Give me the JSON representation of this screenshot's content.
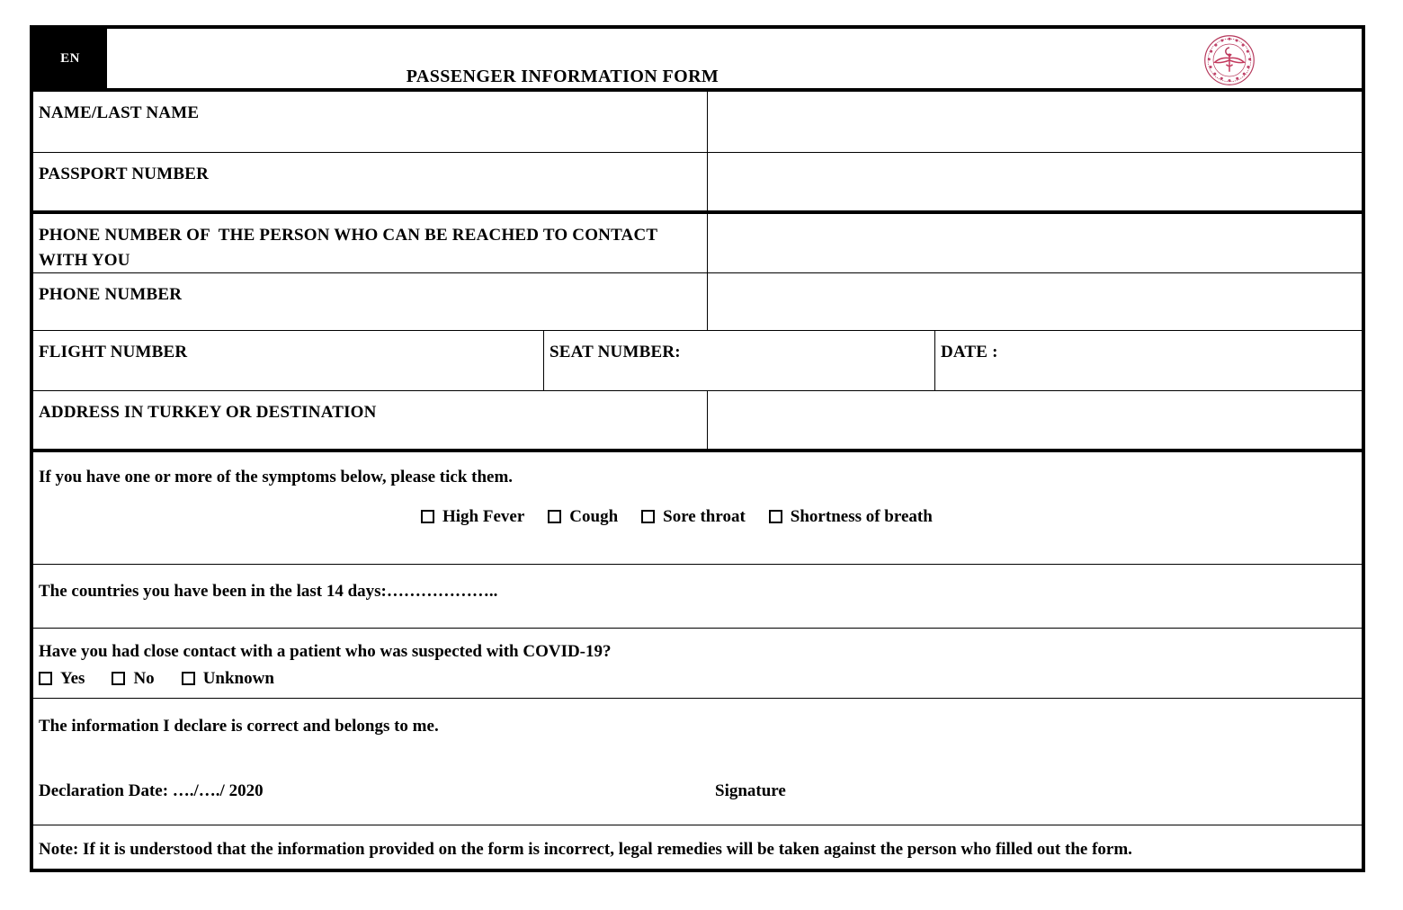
{
  "header": {
    "language_badge": "EN",
    "title": "PASSENGER INFORMATION FORM",
    "seal_name": "ministry-of-health-seal",
    "seal_color": "#b5365a"
  },
  "fields": [
    {
      "label": "NAME/LAST NAME",
      "value": ""
    },
    {
      "label": "PASSPORT NUMBER",
      "value": ""
    },
    {
      "label": "PHONE NUMBER OF  THE PERSON WHO CAN BE REACHED TO CONTACT WITH YOU",
      "value": ""
    },
    {
      "label": "PHONE NUMBER",
      "value": ""
    }
  ],
  "flight_row": {
    "flight_label": "FLIGHT NUMBER",
    "flight_value": "",
    "seat_label": "SEAT NUMBER:",
    "seat_value": "",
    "date_label": "DATE :",
    "date_value": ""
  },
  "address_row": {
    "label": "ADDRESS IN TURKEY OR DESTINATION",
    "value": ""
  },
  "symptoms": {
    "prompt": "If you have one or more of the symptoms below, please tick them.",
    "options": [
      "High Fever",
      "Cough",
      "Sore throat",
      "Shortness of breath"
    ]
  },
  "countries": {
    "text": "The countries you have been in the last 14 days:……………….."
  },
  "contact_question": {
    "question": "Have you had close contact with a patient who was suspected with COVID-19?",
    "options": [
      "Yes",
      "No",
      "Unknown"
    ]
  },
  "declaration": {
    "statement": "The information I declare is correct and belongs to me.",
    "date_label": "Declaration Date: …./…./ 2020",
    "signature_label": "Signature"
  },
  "note": {
    "text": "Note: If it is understood that the information provided on the form is incorrect, legal remedies will be taken against the person who filled out the form."
  }
}
